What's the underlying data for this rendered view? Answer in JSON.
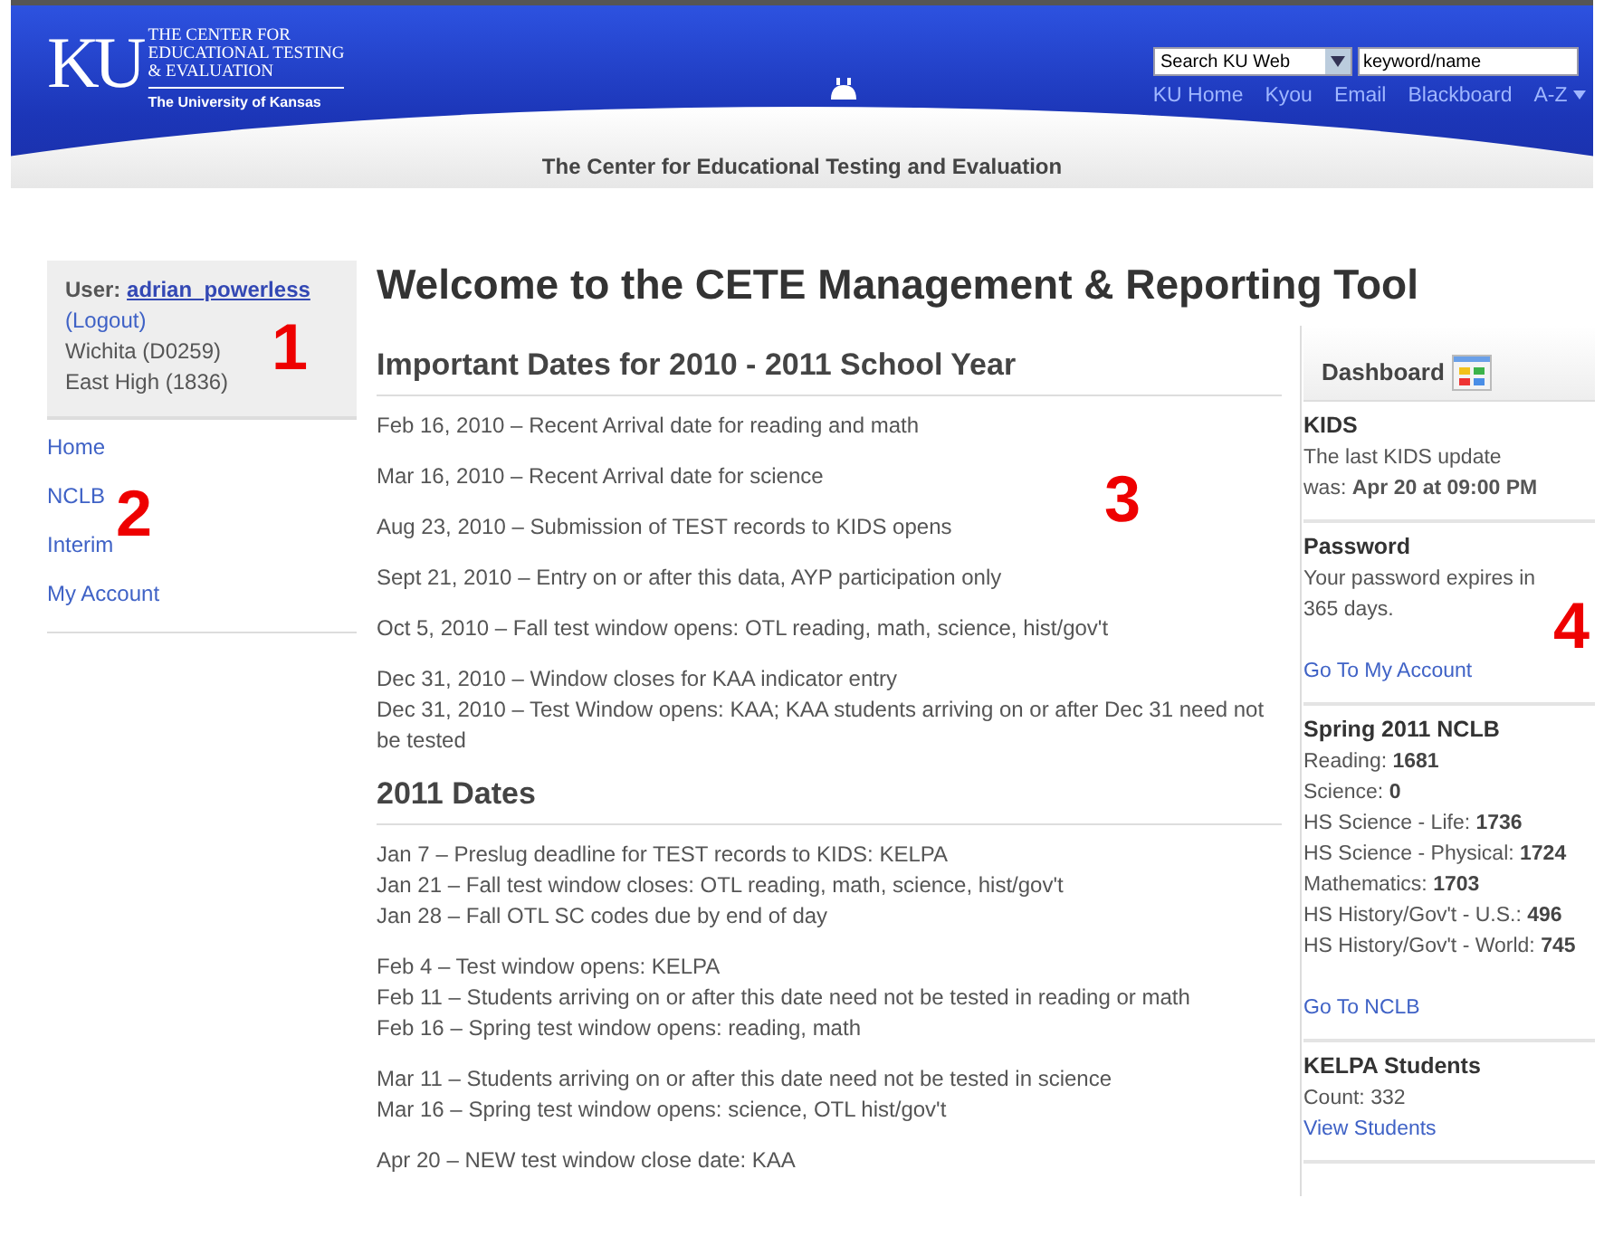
{
  "header": {
    "logo_mark": "KU",
    "logo_lines": [
      "THE CENTER FOR",
      "EDUCATIONAL TESTING",
      "& EVALUATION"
    ],
    "university": "The University of Kansas",
    "search_scope": "Search KU Web",
    "search_value": "keyword/name",
    "links": [
      "KU Home",
      "Kyou",
      "Email",
      "Blackboard",
      "A-Z"
    ],
    "banner_title": "The Center for Educational Testing and Evaluation"
  },
  "user_box": {
    "label": "User:",
    "username": "adrian_powerless",
    "logout": "(Logout)",
    "district": "Wichita (D0259)",
    "school": "East High (1836)"
  },
  "nav": [
    "Home",
    "NCLB",
    "Interim",
    "My Account"
  ],
  "page_title": "Welcome to the CETE Management & Reporting Tool",
  "sections": [
    {
      "heading": "Important Dates for 2010 - 2011 School Year",
      "groups": [
        [
          "Feb 16, 2010 – Recent Arrival date for reading and math"
        ],
        [
          "Mar 16, 2010 – Recent Arrival date for science"
        ],
        [
          "Aug 23, 2010 – Submission of TEST records to KIDS opens"
        ],
        [
          "Sept 21, 2010 – Entry on or after this data, AYP participation only"
        ],
        [
          "Oct 5, 2010 – Fall test window opens: OTL reading, math, science, hist/gov't"
        ],
        [
          "Dec 31, 2010 – Window closes for KAA indicator entry",
          "Dec 31, 2010 – Test Window opens: KAA; KAA students arriving on or after Dec 31 need not be tested"
        ]
      ]
    },
    {
      "heading": "2011 Dates",
      "groups": [
        [
          "Jan 7 – Preslug deadline for TEST records to KIDS: KELPA",
          "Jan 21 – Fall test window closes: OTL reading, math, science, hist/gov't",
          "Jan 28 – Fall OTL SC codes due by end of day"
        ],
        [
          "Feb 4 – Test window opens: KELPA",
          "Feb 11 – Students arriving on or after this date need not be tested in reading or math",
          "Feb 16 – Spring test window opens: reading, math"
        ],
        [
          "Mar 11 – Students arriving on or after this date need not be tested in science",
          "Mar 16 – Spring test window opens: science, OTL hist/gov't"
        ],
        [
          "Apr 20 – NEW test window close date: KAA"
        ]
      ]
    }
  ],
  "dashboard": {
    "title": "Dashboard",
    "panels": [
      {
        "kind": "text",
        "heading": "KIDS",
        "text": "The last KIDS update was: **Apr 20 at 09:00 PM**"
      },
      {
        "kind": "text",
        "heading": "Password",
        "text": "Your password expires in 365 days.",
        "link": "Go To My Account"
      },
      {
        "kind": "stats",
        "heading": "Spring 2011 NCLB",
        "stats": [
          {
            "label": "Reading:",
            "value": "1681"
          },
          {
            "label": "Science:",
            "value": "0"
          },
          {
            "label": "HS Science - Life:",
            "value": "1736"
          },
          {
            "label": "HS Science - Physical:",
            "value": "1724"
          },
          {
            "label": "Mathematics:",
            "value": "1703"
          },
          {
            "label": "HS History/Gov't - U.S.:",
            "value": "496"
          },
          {
            "label": "HS History/Gov't - World:",
            "value": "745"
          }
        ],
        "link": "Go To NCLB"
      },
      {
        "kind": "count",
        "heading": "KELPA Students",
        "text": "Count: 332",
        "link": "View Students"
      }
    ]
  },
  "callouts": [
    "1",
    "2",
    "3",
    "4"
  ]
}
